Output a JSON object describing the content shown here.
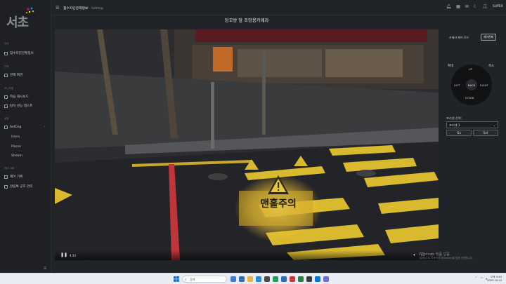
{
  "sidebar": {
    "logo": "서초",
    "sections": [
      {
        "title": "대쉬",
        "items": [
          {
            "label": "침수자단관제정보",
            "icon": "grid-icon"
          }
        ]
      },
      {
        "title": "관제",
        "items": [
          {
            "label": "관제 화면",
            "icon": "monitor-icon"
          }
        ]
      },
      {
        "title": "모니터링",
        "items": [
          {
            "label": "학습 대시보드",
            "icon": "chart-icon"
          },
          {
            "label": "탐지 성능 테스트",
            "icon": "test-icon"
          }
        ]
      },
      {
        "title": "설정",
        "items": [
          {
            "label": "Setting",
            "icon": "gear-icon"
          }
        ],
        "subs": [
          "Users",
          "Places",
          "Stream"
        ]
      },
      {
        "title": "제어 기록",
        "items": [
          {
            "label": "제어 기록",
            "icon": "log-icon"
          },
          {
            "label": "알림톡 공지 관리",
            "icon": "bell-icon"
          }
        ]
      }
    ]
  },
  "header": {
    "breadcrumb": "침수자단관제정보",
    "sub": "Settings",
    "user": "SUPER"
  },
  "page": {
    "title": "장꼬방 앞 조망용카메라"
  },
  "video": {
    "time": "4:33",
    "sign_text": "맨홀주의"
  },
  "camera_control": {
    "label": "카메라 제어 모드",
    "reset": "제어한폐",
    "zoom_in": "확대",
    "zoom_out": "축소",
    "up": "UP",
    "down": "DOWN",
    "left": "LEFT",
    "right": "RIGHT",
    "back": "BACK"
  },
  "preset": {
    "label": "프리셋 선택:",
    "value": "프리셋 1",
    "go": "Go",
    "set": "Set"
  },
  "watermark": {
    "line1": "Windows 정품 인증",
    "line2": "[설정]으로 이동하여 Windows를 정품 인증합니다."
  },
  "taskbar": {
    "search": "검색",
    "time": "오후 4:43",
    "date": "2025-10-15"
  }
}
